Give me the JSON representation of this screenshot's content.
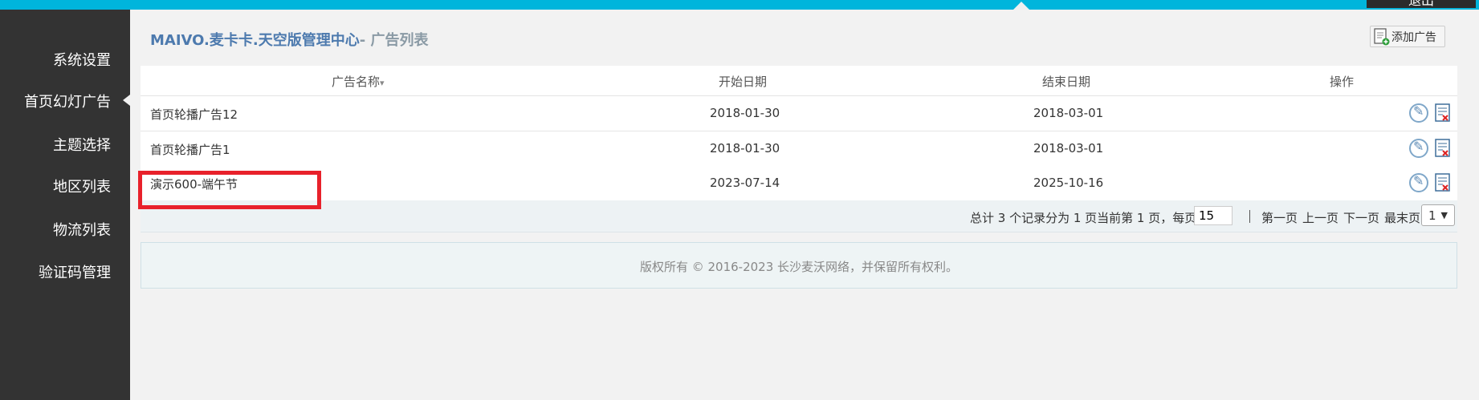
{
  "topbar": {
    "logout_label": "退出"
  },
  "sidebar": {
    "items": [
      {
        "label": "系统设置",
        "active": false
      },
      {
        "label": "首页幻灯广告",
        "active": true
      },
      {
        "label": "主题选择",
        "active": false
      },
      {
        "label": "地区列表",
        "active": false
      },
      {
        "label": "物流列表",
        "active": false
      },
      {
        "label": "验证码管理",
        "active": false
      }
    ]
  },
  "header": {
    "title": "MAIVO.麦卡卡.天空版管理中心",
    "subtitle": "- 广告列表",
    "add_button_label": "添加广告"
  },
  "table": {
    "columns": [
      "广告名称",
      "开始日期",
      "结束日期",
      "操作"
    ],
    "sort_indicator": "▾",
    "rows": [
      {
        "name": "首页轮播广告12",
        "start": "2018-01-30",
        "end": "2018-03-01"
      },
      {
        "name": "首页轮播广告1",
        "start": "2018-01-30",
        "end": "2018-03-01"
      },
      {
        "name": "演示600-端午节",
        "start": "2023-07-14",
        "end": "2025-10-16"
      }
    ],
    "row_actions": [
      "edit-icon",
      "delete-icon"
    ]
  },
  "pager": {
    "summary": "总计 3 个记录分为 1 页当前第 1 页，每页",
    "per_page": "15",
    "first": "第一页",
    "prev": "上一页",
    "next": "下一页",
    "last": "最末页",
    "page_select": "1"
  },
  "footer": {
    "copyright": "版权所有 © 2016-2023 长沙麦沃网络，并保留所有权利。"
  },
  "colors": {
    "accent": "#00b5dc",
    "sidebar_bg": "#333333",
    "title": "#4d7aae",
    "highlight": "#e8212b"
  }
}
